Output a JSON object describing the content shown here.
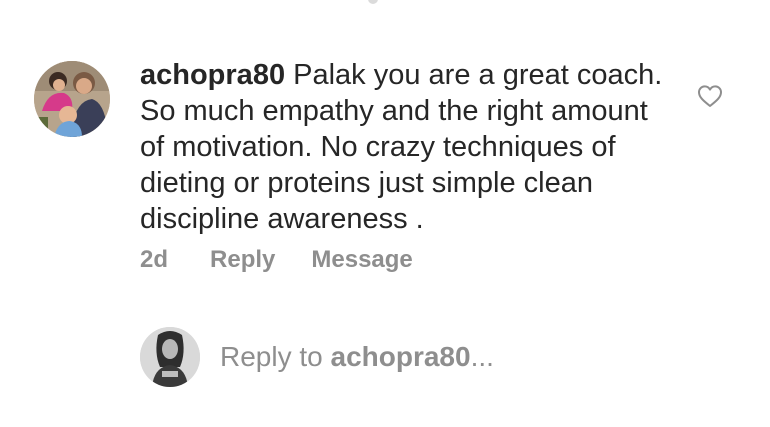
{
  "comment": {
    "username": "achopra80",
    "text": "Palak you are a great coach. So much empathy and the right amount of motivation. No crazy techniques of dieting or proteins just simple clean discipline awareness .",
    "time": "2d",
    "reply_label": "Reply",
    "message_label": "Message",
    "like_icon": "heart-outline-icon"
  },
  "reply_box": {
    "prefix": "Reply to ",
    "username": "achopra80",
    "suffix": "..."
  },
  "colors": {
    "text": "#262626",
    "secondary": "#8e8e8e",
    "background": "#ffffff"
  }
}
